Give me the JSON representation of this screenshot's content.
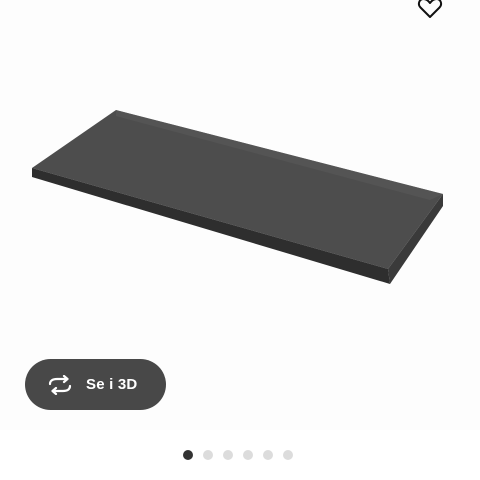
{
  "product": {
    "image": "worktop-dark-grey"
  },
  "favorite": {
    "icon": "heart-icon"
  },
  "view3d": {
    "label": "Se i 3D",
    "icon": "rotate-3d-icon"
  },
  "carousel": {
    "total": 6,
    "active_index": 0
  },
  "colors": {
    "button_bg": "#484848",
    "dot_active": "#333333",
    "dot_inactive": "#dcdcdc",
    "worktop": "#4a4a4a"
  }
}
